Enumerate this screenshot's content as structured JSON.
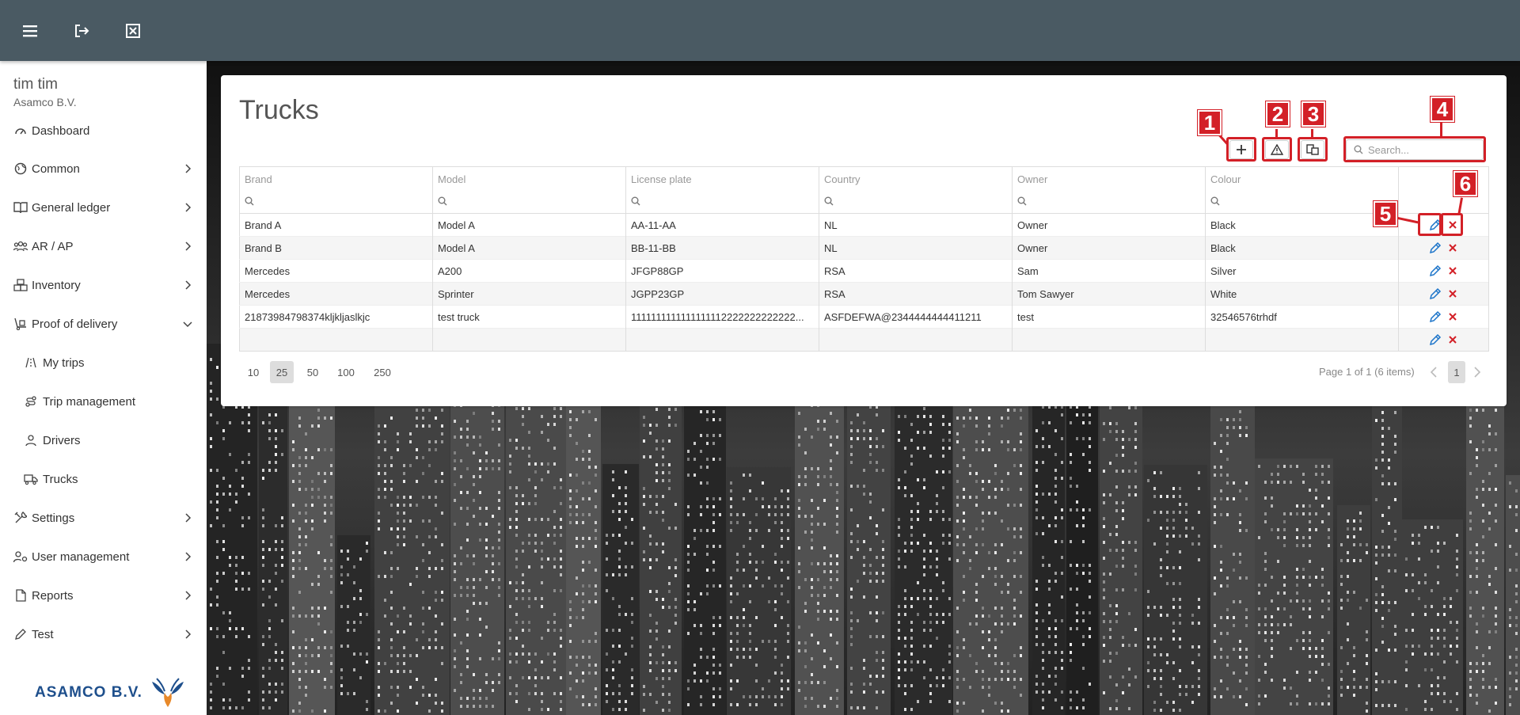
{
  "topbar": {
    "icons": [
      "menu-icon",
      "logout-icon",
      "close-window-icon"
    ]
  },
  "user": {
    "name": "tim tim",
    "company": "Asamco B.V."
  },
  "sidebar": {
    "items": [
      {
        "label": "Dashboard",
        "icon": "speedometer-icon"
      },
      {
        "label": "Common",
        "icon": "globe-icon"
      },
      {
        "label": "General ledger",
        "icon": "book-icon"
      },
      {
        "label": "AR / AP",
        "icon": "users-icon"
      },
      {
        "label": "Inventory",
        "icon": "boxes-icon"
      },
      {
        "label": "Proof of delivery",
        "icon": "hand-truck-icon"
      },
      {
        "label": "My trips",
        "icon": "road-icon"
      },
      {
        "label": "Trip management",
        "icon": "route-icon"
      },
      {
        "label": "Drivers",
        "icon": "person-icon"
      },
      {
        "label": "Trucks",
        "icon": "truck-icon"
      },
      {
        "label": "Settings",
        "icon": "tools-icon"
      },
      {
        "label": "User management",
        "icon": "user-gear-icon"
      },
      {
        "label": "Reports",
        "icon": "file-icon"
      },
      {
        "label": "Test",
        "icon": "pencil-icon"
      }
    ]
  },
  "logo": {
    "text": "ASAMCO B.V."
  },
  "page": {
    "title": "Trucks"
  },
  "toolbar": {
    "search_placeholder": "Search..."
  },
  "callouts": [
    "1",
    "2",
    "3",
    "4",
    "5",
    "6"
  ],
  "grid": {
    "columns": [
      "Brand",
      "Model",
      "License plate",
      "Country",
      "Owner",
      "Colour"
    ],
    "rows": [
      [
        "Brand A",
        "Model A",
        "AA-11-AA",
        "NL",
        "Owner",
        "Black"
      ],
      [
        "Brand B",
        "Model A",
        "BB-11-BB",
        "NL",
        "Owner",
        "Black"
      ],
      [
        "Mercedes",
        "A200",
        "JFGP88GP",
        "RSA",
        "Sam",
        "Silver"
      ],
      [
        "Mercedes",
        "Sprinter",
        "JGPP23GP",
        "RSA",
        "Tom Sawyer",
        "White"
      ],
      [
        "21873984798374kljkljaslkjc",
        "test truck",
        "1111111111111111112222222222222...",
        "ASFDEFWA@2344444444411211",
        "test",
        "32546576trhdf"
      ],
      [
        "",
        "",
        "",
        "",
        "",
        ""
      ]
    ]
  },
  "pager": {
    "sizes": [
      "10",
      "25",
      "50",
      "100",
      "250"
    ],
    "active_size": "25",
    "info": "Page 1 of 1 (6 items)",
    "current": "1"
  },
  "colors": {
    "topbar": "#4a5a63",
    "accent": "#1a73c9",
    "delete": "#d32027",
    "callout": "#d32027"
  }
}
